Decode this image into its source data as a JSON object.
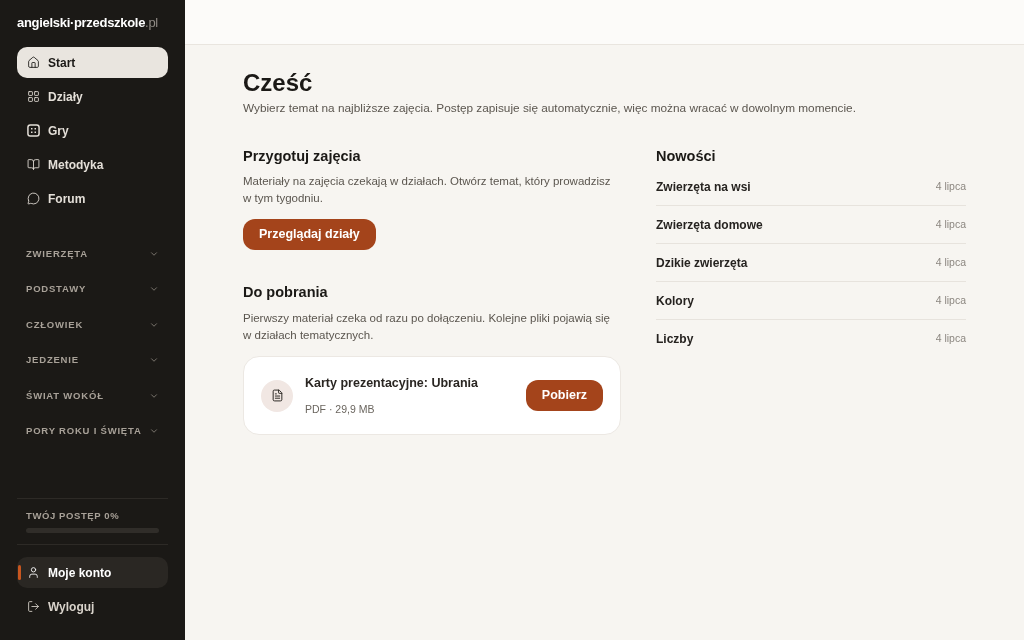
{
  "sidebar": {
    "logo": {
      "name": "angielski·przedszkole",
      "suffix": ".pl"
    },
    "nav": [
      {
        "label": "Start",
        "selected": true
      },
      {
        "label": "Działy",
        "selected": false
      },
      {
        "label": "Gry",
        "selected": false
      },
      {
        "label": "Metodyka",
        "selected": false
      },
      {
        "label": "Forum",
        "selected": false
      }
    ],
    "sections": [
      {
        "label": "ZWIERZĘTA",
        "expanded": false
      },
      {
        "label": "PODSTAWY",
        "expanded": false
      },
      {
        "label": "CZŁOWIEK",
        "expanded": false
      },
      {
        "label": "JEDZENIE",
        "expanded": false
      },
      {
        "label": "ŚWIAT WOKÓŁ",
        "expanded": false
      },
      {
        "label": "PORY ROKU I ŚWIĘTA",
        "expanded": false
      }
    ],
    "progress": {
      "label": "TWÓJ POSTĘP 0%"
    },
    "account": [
      {
        "label": "Moje konto",
        "selected": true
      },
      {
        "label": "Wyloguj",
        "selected": false
      }
    ]
  },
  "main": {
    "title": "Cześć",
    "subtitle": "Wybierz temat na najbliższe zajęcia. Postęp zapisuje się automatycznie, więc można wracać w dowolnym momencie.",
    "prepare": {
      "heading": "Przygotuj zajęcia",
      "text": "Materiały na zajęcia czekają w działach. Otwórz temat, który prowadzisz w tym tygodniu.",
      "button": "Przeglądaj działy"
    },
    "downloads": {
      "heading": "Do pobrania",
      "text": "Pierwszy materiał czeka od razu po dołączeniu. Kolejne pliki pojawią się w działach tematycznych.",
      "files": [
        {
          "title": "Karty prezentacyjne: Ubrania",
          "meta": "PDF · 29,9 MB",
          "button": "Pobierz"
        }
      ]
    },
    "news": {
      "heading": "Nowości",
      "items": [
        {
          "title": "Zwierzęta na wsi",
          "date": "4 lipca"
        },
        {
          "title": "Zwierzęta domowe",
          "date": "4 lipca"
        },
        {
          "title": "Dzikie zwierzęta",
          "date": "4 lipca"
        },
        {
          "title": "Kolory",
          "date": "4 lipca"
        },
        {
          "title": "Liczby",
          "date": "4 lipca"
        }
      ]
    }
  }
}
